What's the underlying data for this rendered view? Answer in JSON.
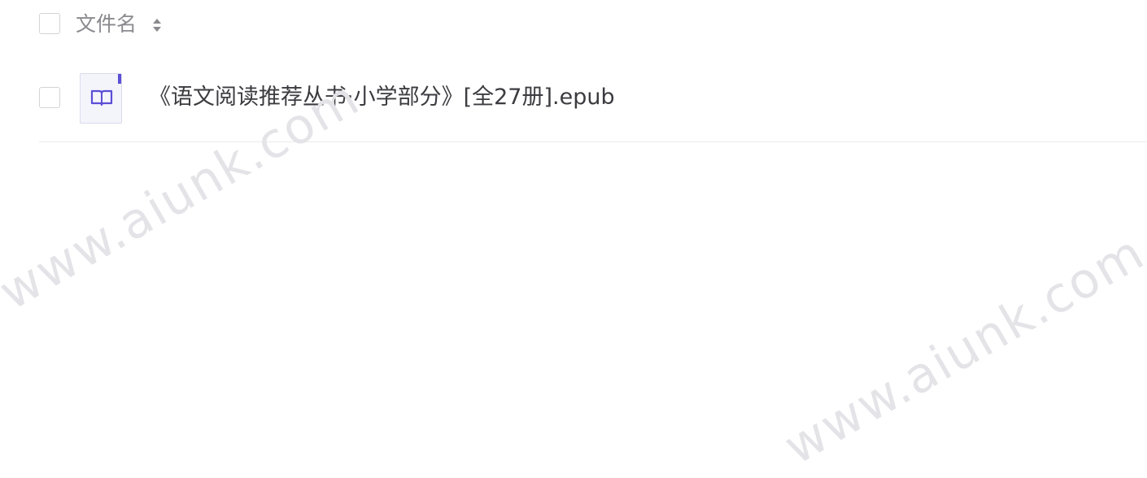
{
  "file_list": {
    "header": {
      "column_title": "文件名",
      "sort_icon": "sort-updown-icon"
    },
    "rows": [
      {
        "name": "《语文阅读推荐丛书·小学部分》[全27册].epub",
        "icon": "epub-book-icon",
        "icon_color": "#5b4fd6"
      }
    ]
  },
  "watermarks": [
    "www.aiunk.com",
    "www.aiunk.com"
  ],
  "colors": {
    "accent": "#5b4fd6",
    "text": "#3b3b40",
    "header_text": "#8a8a8f",
    "divider": "#ececee"
  }
}
